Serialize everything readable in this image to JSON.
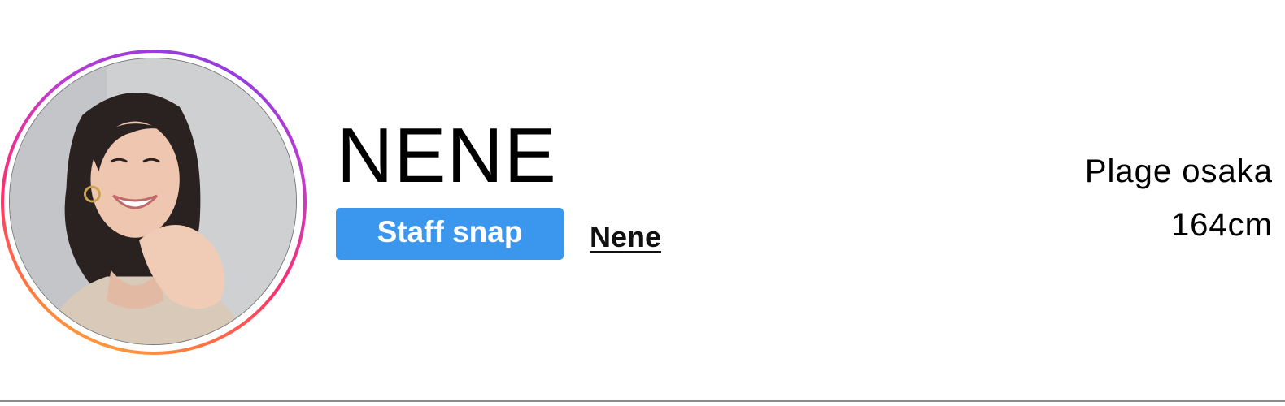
{
  "profile": {
    "name": "NENE",
    "avatar_alt": "profile photo of staff member",
    "avatar_ring_colors": [
      "#7b3fe4",
      "#c13ad0",
      "#ff2f6e",
      "#ff7a3d",
      "#ffc53d"
    ]
  },
  "tags": {
    "staff_snap_label": "Staff snap",
    "staff_snap_color": "#3b97ee",
    "staff_name_link": "Nene"
  },
  "meta": {
    "shop": "Plage osaka",
    "height": "164cm"
  }
}
